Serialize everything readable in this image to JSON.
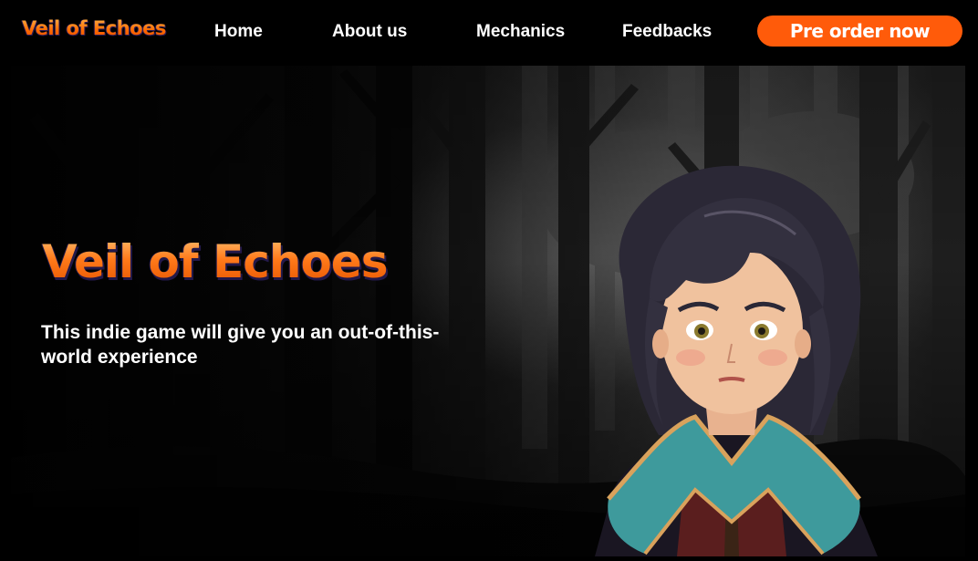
{
  "nav": {
    "logo": "Veil of Echoes",
    "links": [
      {
        "label": "Home"
      },
      {
        "label": "About us"
      },
      {
        "label": "Mechanics"
      },
      {
        "label": "Feedbacks"
      }
    ],
    "cta_label": "Pre order now"
  },
  "hero": {
    "title": "Veil of Echoes",
    "subtitle": "This indie game will give you an out-of-this-world experience"
  },
  "colors": {
    "accent": "#ff5b0a",
    "title_gradient_top": "#ffc070",
    "title_gradient_bottom": "#e65400",
    "background": "#000000"
  }
}
